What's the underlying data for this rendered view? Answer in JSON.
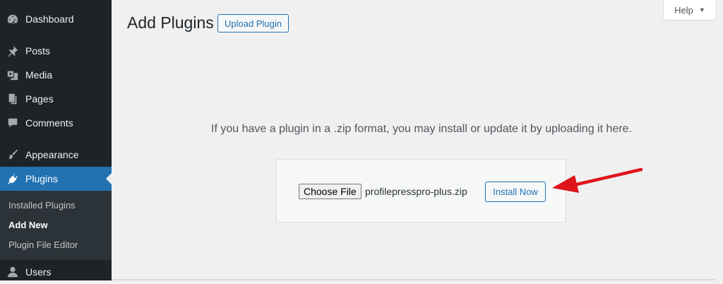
{
  "sidebar": {
    "items": [
      {
        "label": "Dashboard",
        "icon": "dashboard-icon"
      },
      {
        "label": "Posts",
        "icon": "pin-icon"
      },
      {
        "label": "Media",
        "icon": "media-icon"
      },
      {
        "label": "Pages",
        "icon": "pages-icon"
      },
      {
        "label": "Comments",
        "icon": "comment-icon"
      },
      {
        "label": "Appearance",
        "icon": "paintbrush-icon"
      },
      {
        "label": "Plugins",
        "icon": "plug-icon"
      },
      {
        "label": "Users",
        "icon": "user-icon"
      }
    ],
    "submenu": [
      {
        "label": "Installed Plugins"
      },
      {
        "label": "Add New"
      },
      {
        "label": "Plugin File Editor"
      }
    ]
  },
  "header": {
    "title": "Add Plugins",
    "upload_label": "Upload Plugin",
    "help_label": "Help"
  },
  "main": {
    "instructions": "If you have a plugin in a .zip format, you may install or update it by uploading it here.",
    "choose_file_label": "Choose File",
    "file_name": "profilepresspro-plus.zip",
    "install_label": "Install Now"
  },
  "colors": {
    "accent": "#2271b1",
    "sidebar": "#1d2327",
    "arrow": "#e0141c"
  }
}
